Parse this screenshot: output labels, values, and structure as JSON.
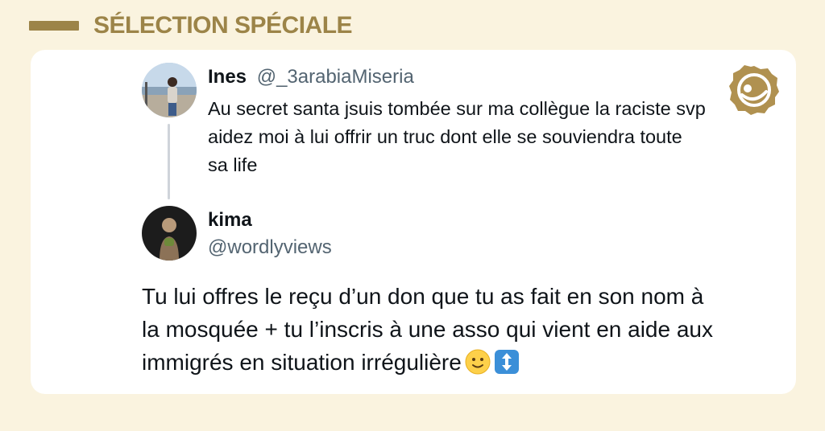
{
  "header": {
    "title": "SÉLECTION SPÉCIALE"
  },
  "quoted_tweet": {
    "name": "Ines",
    "handle": "@_3arabiaMiseria",
    "text": "Au secret santa jsuis tombée sur ma collègue la raciste svp aidez moi à lui offrir un truc dont elle se souviendra toute sa life"
  },
  "reply_tweet": {
    "name": "kima",
    "handle": "@wordlyviews",
    "text": "Tu lui offres le reçu d’un don que tu as fait en son nom à la mosquée + tu l’inscris à une asso qui vient en aide aux immigrés en situation irrégulière",
    "emojis": [
      "slightly-smiling-face-emoji",
      "up-down-arrow-emoji"
    ]
  },
  "colors": {
    "background": "#faf3df",
    "accent": "#9c8448",
    "card": "#ffffff",
    "text": "#0f1419",
    "muted": "#536471"
  }
}
